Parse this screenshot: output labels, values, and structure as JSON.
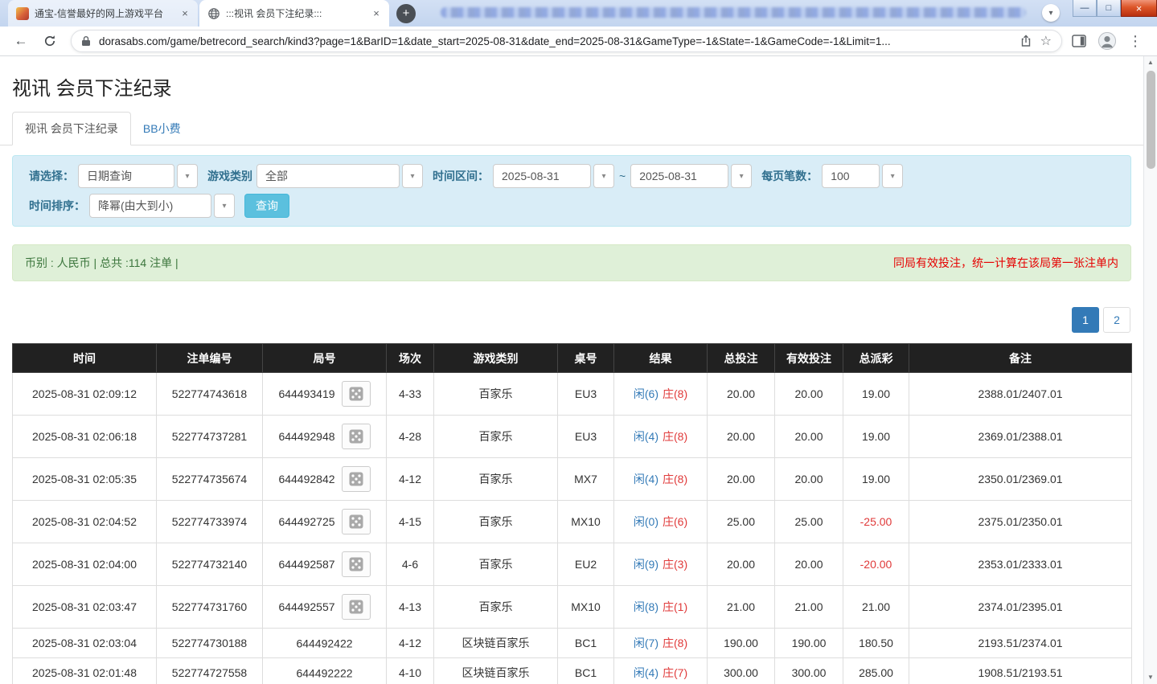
{
  "browser": {
    "tabs": [
      {
        "title": "通宝-信誉最好的网上游戏平台"
      },
      {
        "title": ":::视讯 会员下注纪录:::"
      }
    ],
    "url": "dorasabs.com/game/betrecord_search/kind3?page=1&BarID=1&date_start=2025-08-31&date_end=2025-08-31&GameType=-1&State=-1&GameCode=-1&Limit=1..."
  },
  "icons": {
    "back": "←",
    "star": "☆",
    "menu_dots": "⋮",
    "caret_down": "▾",
    "scroll_up": "▲",
    "scroll_down": "▼",
    "minimize": "—",
    "maximize": "□",
    "close": "×",
    "tab_close": "×",
    "new_tab_plus": "+",
    "chevron_down": "▾"
  },
  "page": {
    "title": "视讯 会员下注纪录",
    "nav_tabs": {
      "active": "视讯 会员下注纪录",
      "secondary": "BB小费"
    },
    "filters": {
      "select_label": "请选择：",
      "select_value": "日期查询",
      "game_type_label": "游戏类别",
      "game_type_value": "全部",
      "date_range_label": "时间区间：",
      "date_start": "2025-08-31",
      "tilde": "~",
      "date_end": "2025-08-31",
      "per_page_label": "每页笔数：",
      "per_page_value": "100",
      "sort_label": "时间排序：",
      "sort_value": "降幂(由大到小)",
      "search_button": "查询"
    },
    "summary": {
      "left": "币别 : 人民币 | 总共 :114 注单 |",
      "right": "同局有效投注，统一计算在该局第一张注单内"
    },
    "pagination": {
      "pages": [
        "1",
        "2"
      ],
      "active": "1"
    },
    "table": {
      "headers": [
        "时间",
        "注单编号",
        "局号",
        "场次",
        "游戏类别",
        "桌号",
        "结果",
        "总投注",
        "有效投注",
        "总派彩",
        "备注"
      ],
      "rows": [
        {
          "time": "2025-08-31 02:09:12",
          "bet_id": "522774743618",
          "round": "644493419",
          "replay": true,
          "session": "4-33",
          "game": "百家乐",
          "table_no": "EU3",
          "player": "闲(6)",
          "banker": "庄(8)",
          "total_bet": "20.00",
          "valid_bet": "20.00",
          "payout": "19.00",
          "note": "2388.01/2407.01"
        },
        {
          "time": "2025-08-31 02:06:18",
          "bet_id": "522774737281",
          "round": "644492948",
          "replay": true,
          "session": "4-28",
          "game": "百家乐",
          "table_no": "EU3",
          "player": "闲(4)",
          "banker": "庄(8)",
          "total_bet": "20.00",
          "valid_bet": "20.00",
          "payout": "19.00",
          "note": "2369.01/2388.01"
        },
        {
          "time": "2025-08-31 02:05:35",
          "bet_id": "522774735674",
          "round": "644492842",
          "replay": true,
          "session": "4-12",
          "game": "百家乐",
          "table_no": "MX7",
          "player": "闲(4)",
          "banker": "庄(8)",
          "total_bet": "20.00",
          "valid_bet": "20.00",
          "payout": "19.00",
          "note": "2350.01/2369.01"
        },
        {
          "time": "2025-08-31 02:04:52",
          "bet_id": "522774733974",
          "round": "644492725",
          "replay": true,
          "session": "4-15",
          "game": "百家乐",
          "table_no": "MX10",
          "player": "闲(0)",
          "banker": "庄(6)",
          "total_bet": "25.00",
          "valid_bet": "25.00",
          "payout": "-25.00",
          "note": "2375.01/2350.01"
        },
        {
          "time": "2025-08-31 02:04:00",
          "bet_id": "522774732140",
          "round": "644492587",
          "replay": true,
          "session": "4-6",
          "game": "百家乐",
          "table_no": "EU2",
          "player": "闲(9)",
          "banker": "庄(3)",
          "total_bet": "20.00",
          "valid_bet": "20.00",
          "payout": "-20.00",
          "note": "2353.01/2333.01"
        },
        {
          "time": "2025-08-31 02:03:47",
          "bet_id": "522774731760",
          "round": "644492557",
          "replay": true,
          "session": "4-13",
          "game": "百家乐",
          "table_no": "MX10",
          "player": "闲(8)",
          "banker": "庄(1)",
          "total_bet": "21.00",
          "valid_bet": "21.00",
          "payout": "21.00",
          "note": "2374.01/2395.01"
        },
        {
          "time": "2025-08-31 02:03:04",
          "bet_id": "522774730188",
          "round": "644492422",
          "replay": false,
          "session": "4-12",
          "game": "区块链百家乐",
          "table_no": "BC1",
          "player": "闲(7)",
          "banker": "庄(8)",
          "total_bet": "190.00",
          "valid_bet": "190.00",
          "payout": "180.50",
          "note": "2193.51/2374.01"
        },
        {
          "time": "2025-08-31 02:01:48",
          "bet_id": "522774727558",
          "round": "644492222",
          "replay": false,
          "session": "4-10",
          "game": "区块链百家乐",
          "table_no": "BC1",
          "player": "闲(4)",
          "banker": "庄(7)",
          "total_bet": "300.00",
          "valid_bet": "300.00",
          "payout": "285.00",
          "note": "1908.51/2193.51"
        }
      ]
    }
  },
  "colors": {
    "accent_blue": "#337ab7",
    "result_player_blue": "#337ab7",
    "result_banker_red": "#e03a3a",
    "negative_red": "#e03a3a",
    "notice_red": "#e60000",
    "filter_panel_bg": "#d9edf7",
    "summary_bg": "#dff0d8",
    "table_header_bg": "#212121",
    "search_button_bg": "#5bc0de"
  }
}
